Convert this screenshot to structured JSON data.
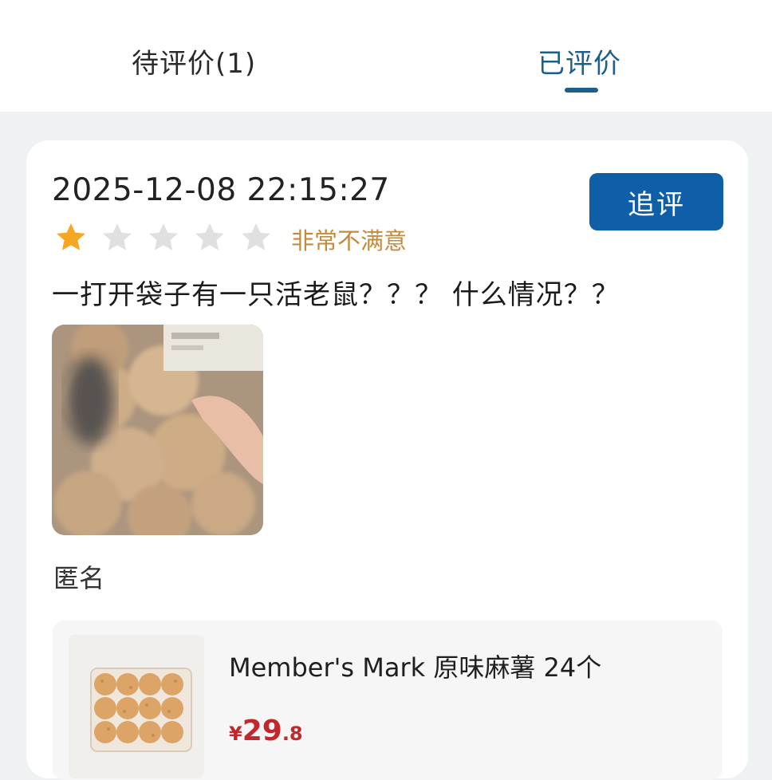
{
  "tabs": {
    "pending": "待评价(1)",
    "done": "已评价"
  },
  "review": {
    "timestamp": "2025-12-08 22:15:27",
    "followup_button": "追评",
    "rating": 1,
    "rating_max": 5,
    "rating_text": "非常不满意",
    "text": "一打开袋子有一只活老鼠？？？ 什么情况？？",
    "author": "匿名"
  },
  "product": {
    "name": "Member's Mark 原味麻薯 24个",
    "price_currency": "¥",
    "price_integer": "29",
    "price_decimal": ".8"
  },
  "colors": {
    "accent": "#1d5f8c",
    "button": "#0f5fa8",
    "star_filled": "#f5a623",
    "star_empty": "#e0e0e0",
    "rating_text": "#c58b3c",
    "price": "#c2272b"
  }
}
